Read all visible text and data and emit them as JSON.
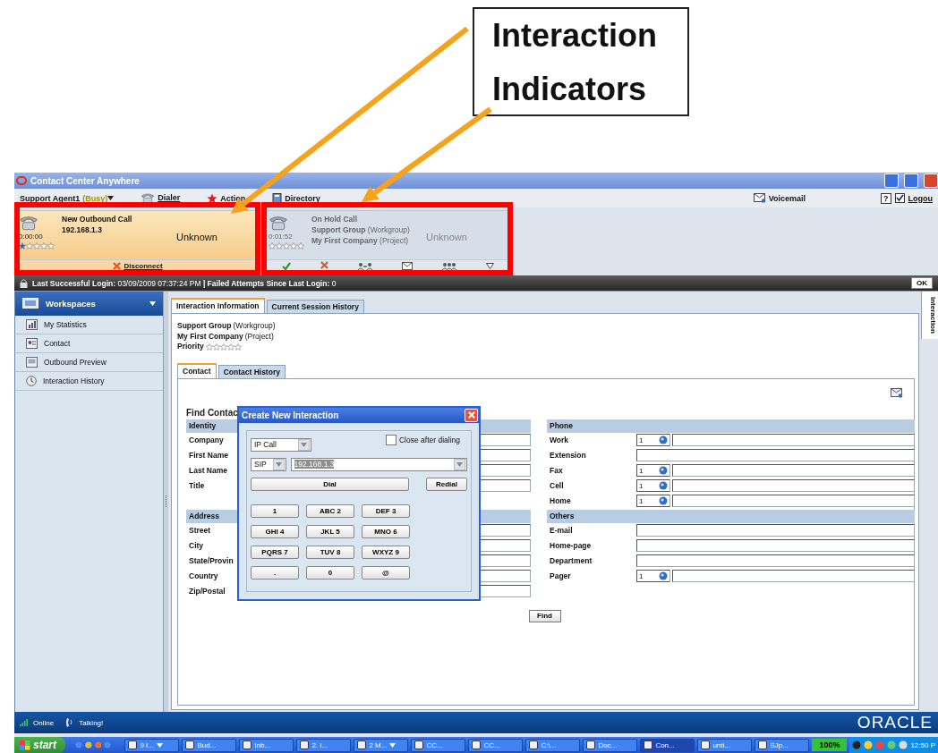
{
  "annotation": {
    "callout": "Interaction Indicators"
  },
  "window": {
    "title": "Contact Center Anywhere"
  },
  "menu": {
    "agent": "Support Agent1",
    "status": "(Busy)",
    "items": [
      {
        "kind": "dialer",
        "label": "Dialer"
      },
      {
        "kind": "action",
        "label": "Action"
      },
      {
        "kind": "directory",
        "label": "Directory"
      }
    ],
    "voicemail": "Voicemail",
    "help": "?",
    "logout": "Logou"
  },
  "interactions": [
    {
      "selected": true,
      "title": "New Outbound Call",
      "lines": [
        "**192.168.1.3**"
      ],
      "status": "Unknown",
      "timer": "0:00:00",
      "stars": 1,
      "actions": [
        {
          "kind": "disconnect",
          "label": "Disconnect"
        }
      ]
    },
    {
      "selected": false,
      "title": "On Hold Call",
      "lines": [
        "**Support Group** (Workgroup)",
        "**My First Company** (Project)"
      ],
      "status": "Unknown",
      "timer": "0:01:52",
      "stars": 0,
      "actions": [
        {
          "kind": "accept"
        },
        {
          "kind": "reject"
        },
        {
          "kind": "transfer"
        },
        {
          "kind": "email"
        },
        {
          "kind": "conference"
        },
        {
          "kind": "more"
        }
      ]
    }
  ],
  "login_bar": {
    "text": "**Last Successful Login:** 03/09/2009 07:37:24 PM **| Failed Attempts Since Last Login:** 0",
    "ok": "OK"
  },
  "sidebar": {
    "header": "Workspaces",
    "items": [
      {
        "kind": "statistics",
        "label": "My Statistics"
      },
      {
        "kind": "contact",
        "label": "Contact"
      },
      {
        "kind": "preview",
        "label": "Outbound Preview"
      },
      {
        "kind": "history",
        "label": "Interaction History"
      }
    ]
  },
  "tabs": [
    {
      "label": "Interaction Information",
      "selected": true
    },
    {
      "label": "Current Session History",
      "selected": false
    }
  ],
  "info": {
    "lines": [
      "**Support Group** (Workgroup)",
      "**My First Company** (Project)"
    ],
    "priority": {
      "label": "Priority",
      "stars": 0
    }
  },
  "subtabs": [
    {
      "label": "Contact",
      "selected": true
    },
    {
      "label": "Contact History",
      "selected": false
    }
  ],
  "form": {
    "title": "Find Contac",
    "left": [
      {
        "heading": "Identity",
        "fields": [
          {
            "label": "Company",
            "kind": "text"
          },
          {
            "label": "First Name",
            "kind": "text"
          },
          {
            "label": "Last Name",
            "kind": "text"
          },
          {
            "label": "Title",
            "kind": "text"
          }
        ]
      },
      {
        "heading": "Address",
        "fields": [
          {
            "label": "Street",
            "kind": "text"
          },
          {
            "label": "City",
            "kind": "text"
          },
          {
            "label": "State/Provin",
            "kind": "text"
          },
          {
            "label": "Country",
            "kind": "text"
          },
          {
            "label": "Zip/Postal",
            "kind": "text"
          }
        ]
      }
    ],
    "right": [
      {
        "heading": "Phone",
        "fields": [
          {
            "label": "Work",
            "kind": "phone",
            "code": "1"
          },
          {
            "label": "Extension",
            "kind": "text"
          },
          {
            "label": "Fax",
            "kind": "phone",
            "code": "1"
          },
          {
            "label": "Cell",
            "kind": "phone",
            "code": "1"
          },
          {
            "label": "Home",
            "kind": "phone",
            "code": "1"
          }
        ]
      },
      {
        "heading": "Others",
        "fields": [
          {
            "label": "E-mail",
            "kind": "text"
          },
          {
            "label": "Home-page",
            "kind": "text"
          },
          {
            "label": "Department",
            "kind": "text"
          },
          {
            "label": "Pager",
            "kind": "phone",
            "code": "1"
          }
        ]
      }
    ],
    "find": "Find"
  },
  "dialog": {
    "title": "Create New Interaction",
    "call_type": "IP Call",
    "close_after_dialing": {
      "label": "Close after dialing",
      "checked": false
    },
    "protocol": "SIP",
    "address": "192.168.1.3",
    "dial": "Dial",
    "redial": "Redial",
    "keys": [
      "1",
      "ABC 2",
      "DEF 3",
      "GHI 4",
      "JKL 5",
      "MNO 6",
      "PQRS 7",
      "TUV 8",
      "WXYZ 9",
      ".",
      "0",
      "@"
    ]
  },
  "side_tab": "Interaction",
  "status_bar": {
    "online": "Online",
    "talking": "Talking!",
    "logo": "ORACLE"
  },
  "taskbar": {
    "start": "start",
    "tasks": [
      {
        "label": "9 I...",
        "menu": true,
        "selected": false
      },
      {
        "label": "Bud...",
        "menu": false,
        "selected": false
      },
      {
        "label": "Inb...",
        "menu": false,
        "selected": false
      },
      {
        "label": "2. I...",
        "menu": false,
        "selected": false
      },
      {
        "label": "2 M...",
        "menu": true,
        "selected": false
      },
      {
        "label": "CC...",
        "menu": false,
        "selected": false
      },
      {
        "label": "CC...",
        "menu": false,
        "selected": false
      },
      {
        "label": "C:\\...",
        "menu": false,
        "selected": false
      },
      {
        "label": "Doc...",
        "menu": false,
        "selected": false
      },
      {
        "label": "Con...",
        "menu": false,
        "selected": true
      },
      {
        "label": "unti...",
        "menu": false,
        "selected": false
      },
      {
        "label": "SJp...",
        "menu": false,
        "selected": false
      }
    ],
    "zoom": "100%",
    "clock": "12:50 P"
  }
}
